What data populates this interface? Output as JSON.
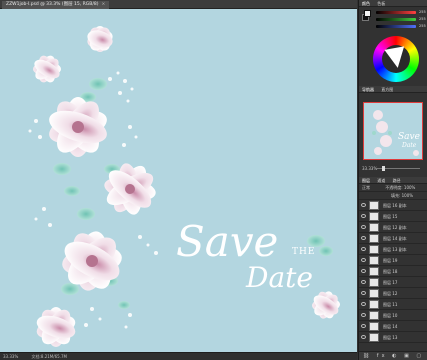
{
  "document": {
    "tab_label": "ZZW1job-Ⅰ.psd @ 33.3% (图层 15, RGB/8)",
    "close_glyph": "×",
    "status_zoom": "33.33%",
    "status_doc": "文档:8.21M/65.7M"
  },
  "artwork": {
    "save": "Save",
    "the": "THE",
    "date": "Date"
  },
  "color_panel": {
    "tabs": [
      "颜色",
      "色板"
    ],
    "sliders": [
      {
        "label": "R",
        "value": "255",
        "color": "#ff5050"
      },
      {
        "label": "G",
        "value": "255",
        "color": "#50d050"
      },
      {
        "label": "B",
        "value": "255",
        "color": "#5a78ff"
      }
    ]
  },
  "navigator": {
    "tabs": [
      "导航器",
      "直方图"
    ],
    "zoom": "33.33%"
  },
  "layers": {
    "tabs": [
      "图层",
      "通道",
      "路径"
    ],
    "blend_mode": "正常",
    "opacity_label": "不透明度: 100%",
    "fill_label": "填充: 100%",
    "rows": [
      {
        "name": "图层 16 副本"
      },
      {
        "name": "图层 15"
      },
      {
        "name": "图层 12 副本"
      },
      {
        "name": "图层 14 副本"
      },
      {
        "name": "图层 13 副本"
      },
      {
        "name": "图层 19"
      },
      {
        "name": "图层 18"
      },
      {
        "name": "图层 17"
      },
      {
        "name": "图层 12"
      },
      {
        "name": "图层 11"
      },
      {
        "name": "图层 10"
      },
      {
        "name": "图层 14"
      },
      {
        "name": "图层 13"
      }
    ],
    "footer_icons": "⛓ fx ◐ ▣ ▢ 🗑"
  }
}
